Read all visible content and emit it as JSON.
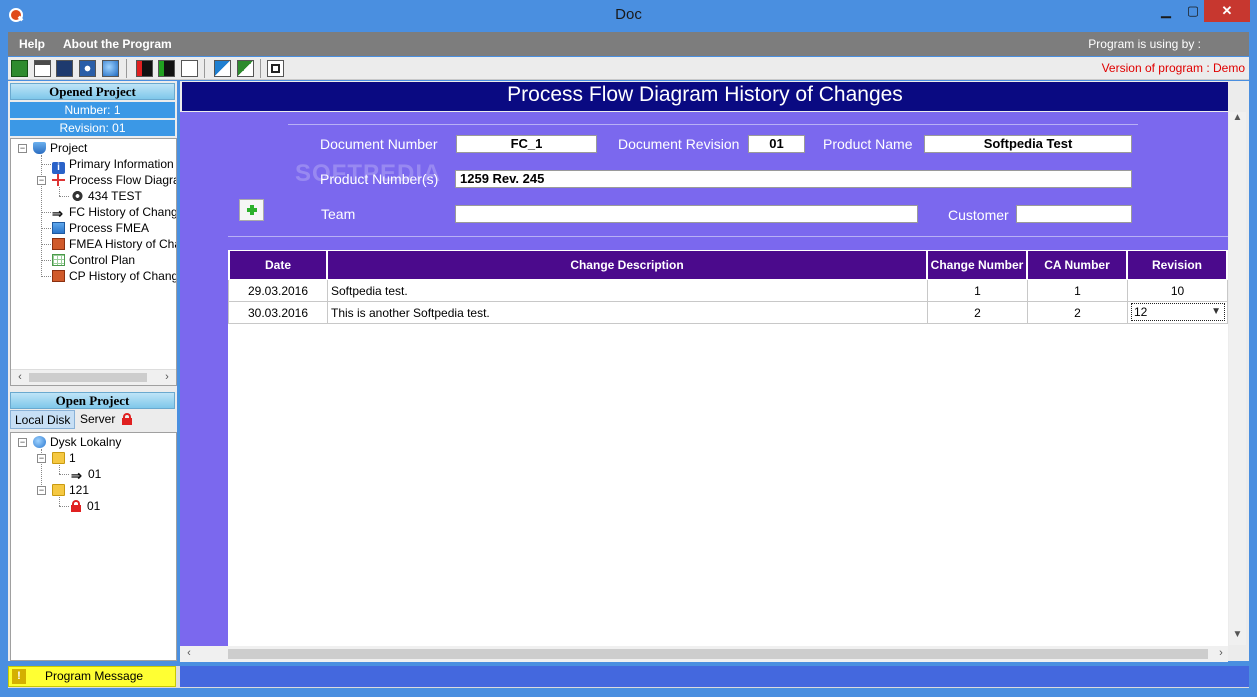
{
  "window": {
    "title": "Doc",
    "minimize": "▁",
    "maximize": "▢",
    "close": "✕"
  },
  "menu": {
    "items": [
      "Help",
      "About the Program"
    ],
    "using_text": "Program is using by :"
  },
  "toolbar": {
    "version_text": "Version of program : Demo"
  },
  "left_panel": {
    "opened_header": "Opened Project",
    "number": "Number: 1",
    "revision": "Revision: 01",
    "project_tree": [
      {
        "label": "Project",
        "icon": "shield-icon"
      },
      {
        "label": "Primary Information",
        "icon": "info-icon"
      },
      {
        "label": "Process Flow Diagram",
        "icon": "tree-icon"
      },
      {
        "label": "434 TEST",
        "icon": "gear-icon"
      },
      {
        "label": "FC History of Change",
        "icon": "arrow-icon"
      },
      {
        "label": "Process FMEA",
        "icon": "doc-icon"
      },
      {
        "label": "FMEA History of Char",
        "icon": "brick-icon"
      },
      {
        "label": "Control Plan",
        "icon": "grid-icon"
      },
      {
        "label": "CP History of Change",
        "icon": "brick-icon"
      }
    ],
    "open_header": "Open Project",
    "tabs": [
      "Local Disk",
      "Server"
    ],
    "disk_tree": [
      {
        "label": "Dysk Lokalny",
        "icon": "globe-icon"
      },
      {
        "label": "1",
        "icon": "folder-icon"
      },
      {
        "label": "01",
        "icon": "arrow-icon"
      },
      {
        "label": "121",
        "icon": "folder-icon"
      },
      {
        "label": "01",
        "icon": "lock-icon"
      }
    ]
  },
  "main": {
    "title": "Process Flow Diagram History of Changes",
    "watermark": "SOFTPEDIA",
    "labels": {
      "document_number": "Document Number",
      "document_revision": "Document Revision",
      "product_name": "Product Name",
      "product_numbers": "Product Number(s)",
      "team": "Team",
      "customer": "Customer"
    },
    "values": {
      "document_number": "FC_1",
      "document_revision": "01",
      "product_name": "Softpedia Test",
      "product_numbers": "1259 Rev. 245",
      "team": "",
      "customer": ""
    },
    "table": {
      "headers": [
        "Date",
        "Change Description",
        "Change Number",
        "CA Number",
        "Revision"
      ],
      "rows": [
        [
          "29.03.2016",
          "Softpedia test.",
          "1",
          "1",
          "10"
        ],
        [
          "30.03.2016",
          "This is another Softpedia test.",
          "2",
          "2",
          "12"
        ]
      ]
    }
  },
  "status": {
    "label": "Program Message",
    "warn": "!"
  },
  "colors": {
    "accent": "#0a0a82",
    "form_bg": "#7b68ee",
    "table_header": "#4b0a8c",
    "info_row": "#3b98e6",
    "version": "#e00000"
  }
}
